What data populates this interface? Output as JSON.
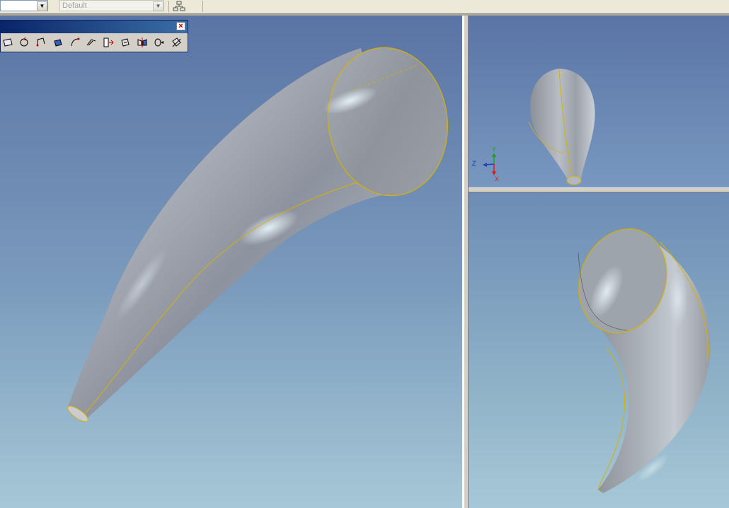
{
  "toolbar": {
    "style_combo_value": "",
    "default_combo_value": "Default",
    "tree_icon": "tree-structure-icon"
  },
  "palette": {
    "close_icon": "close-icon",
    "tools": [
      "sketch-plane-icon",
      "rotate-icon",
      "line-icon",
      "extrude-icon",
      "arc-icon",
      "sweep-icon",
      "split-icon",
      "revolve-icon",
      "mirror-icon",
      "loft-icon",
      "fillet-icon"
    ]
  },
  "viewports": {
    "main": "isometric-view",
    "top_right": "top-view",
    "bottom_right": "side-view"
  },
  "triad": {
    "z_label": "Z",
    "y_label": "Y",
    "x_label": "X"
  },
  "colors": {
    "edge_highlight": "#d8b000",
    "background_top": "#5a74a5",
    "background_bottom": "#a6c8d6",
    "surface": "#a9adb4"
  }
}
